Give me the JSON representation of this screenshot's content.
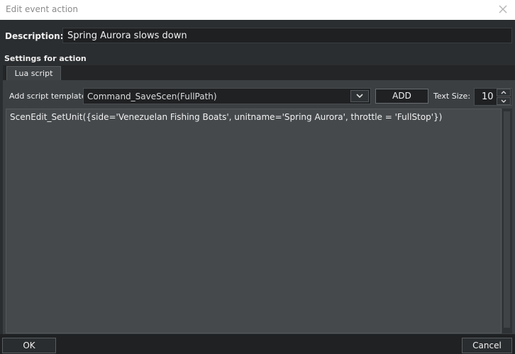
{
  "window": {
    "title": "Edit event action",
    "close_icon": "close-icon"
  },
  "description": {
    "label": "Description:",
    "value": "Spring Aurora slows down"
  },
  "settings": {
    "label": "Settings for action",
    "tabs": [
      {
        "label": "Lua script",
        "active": true
      }
    ]
  },
  "template": {
    "label": "Add script template",
    "selected": "Command_SaveScen(FullPath)",
    "dropdown_icon": "chevron-down-icon",
    "add_label": "ADD"
  },
  "text_size": {
    "label": "Text Size:",
    "value": "10",
    "up_icon": "chevron-up-icon",
    "down_icon": "chevron-down-icon"
  },
  "editor": {
    "code": "ScenEdit_SetUnit({side='Venezuelan Fishing Boats', unitname='Spring Aurora', throttle = 'FullStop'})"
  },
  "footer": {
    "ok_label": "OK",
    "cancel_label": "Cancel"
  },
  "colors": {
    "background": "#2b2e30",
    "editor_bg": "#45494c",
    "titlebar_bg": "#ffffff"
  }
}
